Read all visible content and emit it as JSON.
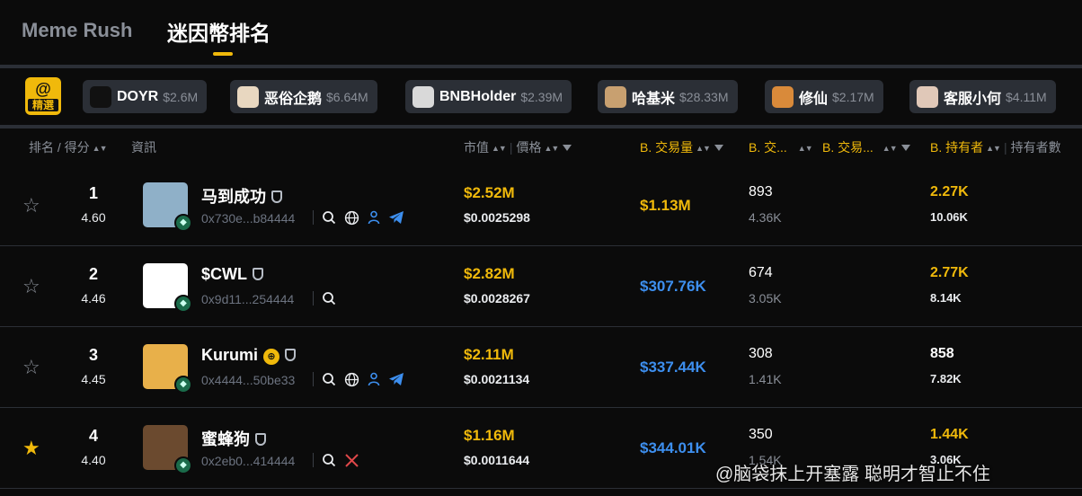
{
  "tabs": {
    "meme_rush": "Meme Rush",
    "meme_ranking": "迷因幣排名"
  },
  "featured": {
    "logo_symbol": "@",
    "logo_label": "精選",
    "chips": [
      {
        "name": "DOYR",
        "mcap": "$2.6M",
        "color": "#111111"
      },
      {
        "name": "恶俗企鹅",
        "mcap": "$6.64M",
        "color": "#e8d7c0"
      },
      {
        "name": "BNBHolder",
        "mcap": "$2.39M",
        "color": "#d9d9d9"
      },
      {
        "name": "哈基米",
        "mcap": "$28.33M",
        "color": "#c8a070"
      },
      {
        "name": "修仙",
        "mcap": "$2.17M",
        "color": "#d98a3a"
      },
      {
        "name": "客服小何",
        "mcap": "$4.11M",
        "color": "#e0c8b8"
      }
    ]
  },
  "columns": {
    "rank_score": "排名 / 得分",
    "info": "資訊",
    "mcap": "市值",
    "price": "價格",
    "volume": "B. 交易量",
    "tx": "B. 交...",
    "traders": "B. 交易...",
    "holders": "B. 持有者",
    "holder_count": "持有者數"
  },
  "rows": [
    {
      "starred": false,
      "rank": "1",
      "score": "4.60",
      "name": "马到成功",
      "addr": "0x730e...b84444",
      "mcap": "$2.52M",
      "price": "$0.0025298",
      "volume": "$1.13M",
      "volume_color": "#f0b90b",
      "tx": "893",
      "tx2": "4.36K",
      "holders": "2.27K",
      "holders_color": "#f0b90b",
      "holders2": "10.06K",
      "icons": [
        "search-icon",
        "globe-icon",
        "person-icon",
        "telegram-icon"
      ],
      "avatar_color": "#8fb0c8"
    },
    {
      "starred": false,
      "rank": "2",
      "score": "4.46",
      "name": "$CWL",
      "addr": "0x9d11...254444",
      "mcap": "$2.82M",
      "price": "$0.0028267",
      "volume": "$307.76K",
      "volume_color": "#3d8fef",
      "tx": "674",
      "tx2": "3.05K",
      "holders": "2.77K",
      "holders_color": "#f0b90b",
      "holders2": "8.14K",
      "icons": [
        "search-icon"
      ],
      "avatar_color": "#ffffff"
    },
    {
      "starred": false,
      "rank": "3",
      "score": "4.45",
      "name": "Kurumi",
      "addr": "0x4444...50be33",
      "mcap": "$2.11M",
      "price": "$0.0021134",
      "volume": "$337.44K",
      "volume_color": "#3d8fef",
      "tx": "308",
      "tx2": "1.41K",
      "holders": "858",
      "holders_color": "#ffffff",
      "holders2": "7.82K",
      "icons": [
        "search-icon",
        "globe-icon",
        "person-icon",
        "telegram-icon"
      ],
      "avatar_color": "#e8b04a"
    },
    {
      "starred": true,
      "rank": "4",
      "score": "4.40",
      "name": "蜜蜂狗",
      "addr": "0x2eb0...414444",
      "mcap": "$1.16M",
      "price": "$0.0011644",
      "volume": "$344.01K",
      "volume_color": "#3d8fef",
      "tx": "350",
      "tx2": "1.54K",
      "holders": "1.44K",
      "holders_color": "#f0b90b",
      "holders2": "3.06K",
      "icons": [
        "search-icon",
        "x-icon"
      ],
      "avatar_color": "#6b4a2f"
    }
  ],
  "watermark": "@脑袋抹上开塞露 聪明才智止不住"
}
